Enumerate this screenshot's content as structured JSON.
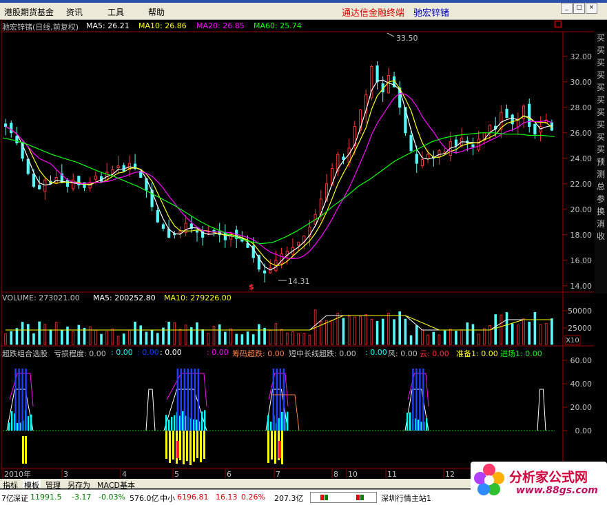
{
  "menu": {
    "items": [
      "港股期货基金",
      "资讯",
      "工具",
      "帮助"
    ],
    "title_red": "通达信金融终端",
    "title_blue": "驰宏锌锗",
    "win_buttons": [
      "_",
      "□",
      "×"
    ]
  },
  "main_panel": {
    "stock": "驰宏锌锗(日线,前复权)",
    "ma5": "MA5: 26.21",
    "ma10": "MA10: 26.86",
    "ma20": "MA20: 26.85",
    "ma60": "MA60: 25.74",
    "high_label": "33.50",
    "low_label": "14.31",
    "dollar_mark": "$",
    "price_ticks": [
      "32.00",
      "30.00",
      "28.00",
      "26.00",
      "24.00",
      "22.00",
      "20.00",
      "18.00",
      "16.00",
      "14.00"
    ],
    "right_tabs": [
      "买",
      "买",
      "买",
      "买",
      "买",
      "买",
      "买",
      "买",
      "买",
      "买",
      "预",
      "测",
      "总",
      "参",
      "换",
      "消",
      "收"
    ]
  },
  "volume_panel": {
    "title": "VOLUME: 273021.00",
    "ma5": "MA5: 200252.80",
    "ma10": "MA10: 279226.00",
    "ticks": [
      "50000",
      "25000"
    ],
    "unit": "X10"
  },
  "indicator_panel": {
    "name": "超跌组合选股",
    "p1": "亏损程度: 0.00",
    "p1b": ": 0.00",
    "p1c": ": 0.00",
    "p1d": ": 0.00",
    "p1e": ": 0.00",
    "p2": "筹码超跌: 0.00",
    "p3": "短中长线超跌: 0.00",
    "p3b": ": 0.00",
    "p4": "风: 0.00",
    "p5": "云: 0.00",
    "p6": "准备1: 0.00",
    "p7": "进场1: 0.00",
    "ticks": [
      "60.00",
      "40.00",
      "20.00",
      "0.00"
    ]
  },
  "time_axis": {
    "labels": [
      "2010年",
      "3",
      "4",
      "5",
      "6",
      "7",
      "8",
      "10",
      "11",
      "12"
    ]
  },
  "bottom_tabs": [
    "指标",
    "模板",
    "管理",
    "另存为",
    "MACD基本"
  ],
  "statusbar": {
    "sz_name": "深证",
    "sz_value": "11991.5",
    "sz_chg": "-3.17",
    "sz_pct": "-0.03%",
    "sz_amt": "576.0亿",
    "zx_name": "中小",
    "zx_value": "6196.81",
    "zx_chg": "16.13",
    "zx_pct": "0.26%",
    "zx_amt": "207.3亿",
    "station": "深圳行情主站1",
    "left_cut": "7亿"
  },
  "watermark": {
    "cn": "分析家公式网",
    "url": "www.88gs.com"
  },
  "chart_data": {
    "type": "candlestick",
    "title": "驰宏锌锗(日线,前复权)",
    "ylim": [
      13.5,
      33.5
    ],
    "x_labels": [
      "2010年",
      "3",
      "4",
      "5",
      "6",
      "7",
      "8",
      "10",
      "11",
      "12"
    ],
    "series": [
      {
        "name": "MA5",
        "color": "#ffffff"
      },
      {
        "name": "MA10",
        "color": "#ffff00"
      },
      {
        "name": "MA20",
        "color": "#ff00ff"
      },
      {
        "name": "MA60",
        "color": "#00ff00"
      }
    ],
    "annotations": [
      {
        "text": "33.50"
      },
      {
        "text": "14.31"
      }
    ],
    "close_series": [
      26.5,
      26.0,
      25.2,
      24.0,
      22.8,
      21.8,
      21.6,
      22.3,
      22.0,
      22.5,
      22.1,
      21.8,
      22.3,
      21.9,
      21.7,
      22.1,
      22.6,
      22.2,
      22.9,
      23.1,
      23.4,
      23.0,
      23.6,
      23.2,
      22.5,
      21.5,
      20.2,
      19.0,
      18.5,
      17.8,
      18.0,
      18.3,
      18.9,
      18.5,
      18.2,
      17.8,
      18.1,
      18.3,
      18.0,
      17.6,
      18.1,
      17.7,
      17.5,
      17.0,
      16.2,
      15.3,
      15.0,
      15.4,
      16.0,
      16.5,
      16.7,
      17.0,
      17.4,
      17.9,
      18.6,
      19.6,
      20.8,
      22.0,
      23.2,
      24.3,
      23.9,
      24.8,
      26.5,
      27.8,
      29.0,
      31.2,
      30.0,
      29.2,
      30.5,
      29.6,
      28.0,
      26.0,
      24.6,
      23.6,
      23.9,
      24.3,
      24.0,
      24.6,
      24.5,
      25.3,
      25.0,
      25.6,
      25.2,
      24.9,
      25.5,
      26.0,
      26.6,
      26.3,
      27.6,
      27.2,
      26.7,
      27.1,
      28.1,
      26.5,
      25.9,
      26.5,
      27.0,
      26.2
    ],
    "ma60_series": [
      25.6,
      25.4,
      25.1,
      24.7,
      24.3,
      24.0,
      23.7,
      23.3,
      22.9,
      22.6,
      22.2,
      21.8,
      21.3,
      20.8,
      20.3,
      19.7,
      19.1,
      18.6,
      18.2,
      17.8,
      17.5,
      17.3,
      17.4,
      17.8,
      18.3,
      18.9,
      19.5,
      20.3,
      21.0,
      21.8,
      22.4,
      23.1,
      23.8,
      24.3,
      24.8,
      25.3,
      25.6,
      25.8,
      25.9,
      26.0,
      26.0,
      25.9,
      25.9,
      25.8,
      25.8,
      25.7
    ],
    "volume": {
      "title": "VOLUME: 273021.00",
      "ylabels": [
        "50000",
        "25000"
      ],
      "unit": "X10"
    },
    "indicator": {
      "title": "超跌组合选股",
      "ylabels": [
        "60.00",
        "40.00",
        "20.00",
        "0.00"
      ]
    }
  }
}
